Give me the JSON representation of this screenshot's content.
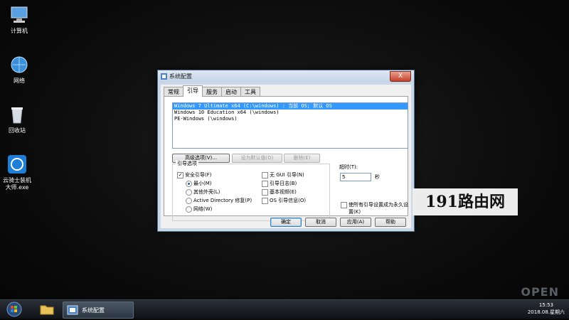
{
  "desktop": {
    "icons": [
      {
        "label": "计算机",
        "icon": "computer-icon"
      },
      {
        "label": "网络",
        "icon": "network-icon"
      },
      {
        "label": "回收站",
        "icon": "recycle-bin-icon"
      },
      {
        "label1": "云骑士装机",
        "label2": "大师.exe",
        "icon": "app-icon"
      }
    ]
  },
  "dialog": {
    "title": "系统配置",
    "close": "X",
    "tabs": [
      "常规",
      "引导",
      "服务",
      "启动",
      "工具"
    ],
    "os_entries": [
      "Windows 7 Ultimate x64 (C:\\windows) : 当前 OS; 默认 OS",
      "Windows 10 Education x64 (\\windows)",
      "PE-Windows (\\windows)"
    ],
    "buttons": {
      "advanced": "高级选项(V)...",
      "set_default": "设为默认值(D)",
      "delete": "删除(E)"
    },
    "boot_options": {
      "legend": "引导选项",
      "safe_boot": "安全引导(F)",
      "minimal": "最小(M)",
      "alternate_shell": "其他外壳(L)",
      "ad_repair": "Active Directory 修复(P)",
      "network": "网络(W)",
      "no_gui": "无 GUI 引导(N)",
      "boot_log": "引导日志(B)",
      "base_video": "基本视频(E)",
      "os_boot_info": "OS 引导信息(O)"
    },
    "timeout": {
      "label": "超时(T):",
      "value": "5",
      "unit": "秒"
    },
    "make_permanent": "使所有引导设置成为永久设置(K)",
    "footer": {
      "ok": "确定",
      "cancel": "取消",
      "apply": "应用(A)",
      "help": "帮助"
    }
  },
  "watermark": "191路由网",
  "taskbar": {
    "app_label": "系统配置",
    "time": "15:53",
    "date": "2018.08.星期六"
  },
  "corner_watermark": "OPEN"
}
